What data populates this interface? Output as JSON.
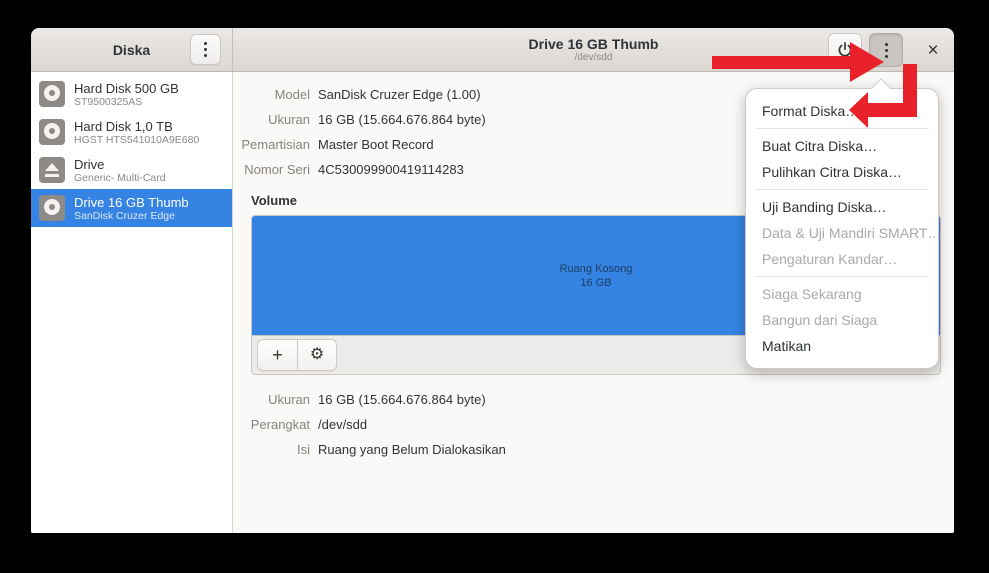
{
  "window": {
    "sidebar": {
      "title": "Diska",
      "items": [
        {
          "title": "Hard Disk 500 GB",
          "subtitle": "ST9500325AS",
          "icon": "disk-icon",
          "selected": false
        },
        {
          "title": "Hard Disk 1,0 TB",
          "subtitle": "HGST HTS541010A9E680",
          "icon": "disk-icon",
          "selected": false
        },
        {
          "title": "Drive",
          "subtitle": "Generic- Multi-Card",
          "icon": "eject-icon",
          "selected": false
        },
        {
          "title": "Drive 16 GB Thumb",
          "subtitle": "SanDisk Cruzer Edge",
          "icon": "disk-icon",
          "selected": true
        }
      ]
    },
    "header": {
      "title": "Drive 16 GB Thumb",
      "subtitle": "/dev/sdd",
      "buttons": [
        "power-icon",
        "menu-icon",
        "close-icon"
      ]
    },
    "drive_info": {
      "rows": [
        {
          "label": "Model",
          "value": "SanDisk Cruzer Edge (1.00)"
        },
        {
          "label": "Ukuran",
          "value": "16 GB (15.664.676.864 byte)"
        },
        {
          "label": "Pemartisian",
          "value": "Master Boot Record"
        },
        {
          "label": "Nomor Seri",
          "value": "4C530099900419114283"
        }
      ]
    },
    "volume": {
      "section_title": "Volume",
      "segment": {
        "line1": "Ruang Kosong",
        "line2": "16 GB",
        "color": "#3584e4"
      },
      "toolbar": {
        "add_icon": "+",
        "settings_icon": "⚙"
      }
    },
    "volume_info": {
      "rows": [
        {
          "label": "Ukuran",
          "value": "16 GB (15.664.676.864 byte)"
        },
        {
          "label": "Perangkat",
          "value": "/dev/sdd"
        },
        {
          "label": "Isi",
          "value": "Ruang yang Belum Dialokasikan"
        }
      ]
    }
  },
  "menu": {
    "items": [
      {
        "label": "Format Diska…",
        "enabled": true
      },
      {
        "label": "Buat Citra Diska…",
        "enabled": true
      },
      {
        "label": "Pulihkan Citra Diska…",
        "enabled": true
      },
      {
        "label": "Uji Banding Diska…",
        "enabled": true
      },
      {
        "label": "Data & Uji Mandiri SMART…",
        "enabled": false
      },
      {
        "label": "Pengaturan Kandar…",
        "enabled": false
      },
      {
        "label": "Siaga Sekarang",
        "enabled": false
      },
      {
        "label": "Bangun dari Siaga",
        "enabled": false
      },
      {
        "label": "Matikan",
        "enabled": true
      }
    ]
  },
  "annotations": {
    "arrow_color": "#e8212a",
    "arrow1_target": "header-menu-button",
    "arrow2_target": "menu-item-format-disk"
  },
  "colors": {
    "accent_blue": "#3584e4",
    "window_bg": "#faf9f7",
    "headerbar_top": "#ebe8e5",
    "headerbar_bottom": "#dbd7d3"
  }
}
